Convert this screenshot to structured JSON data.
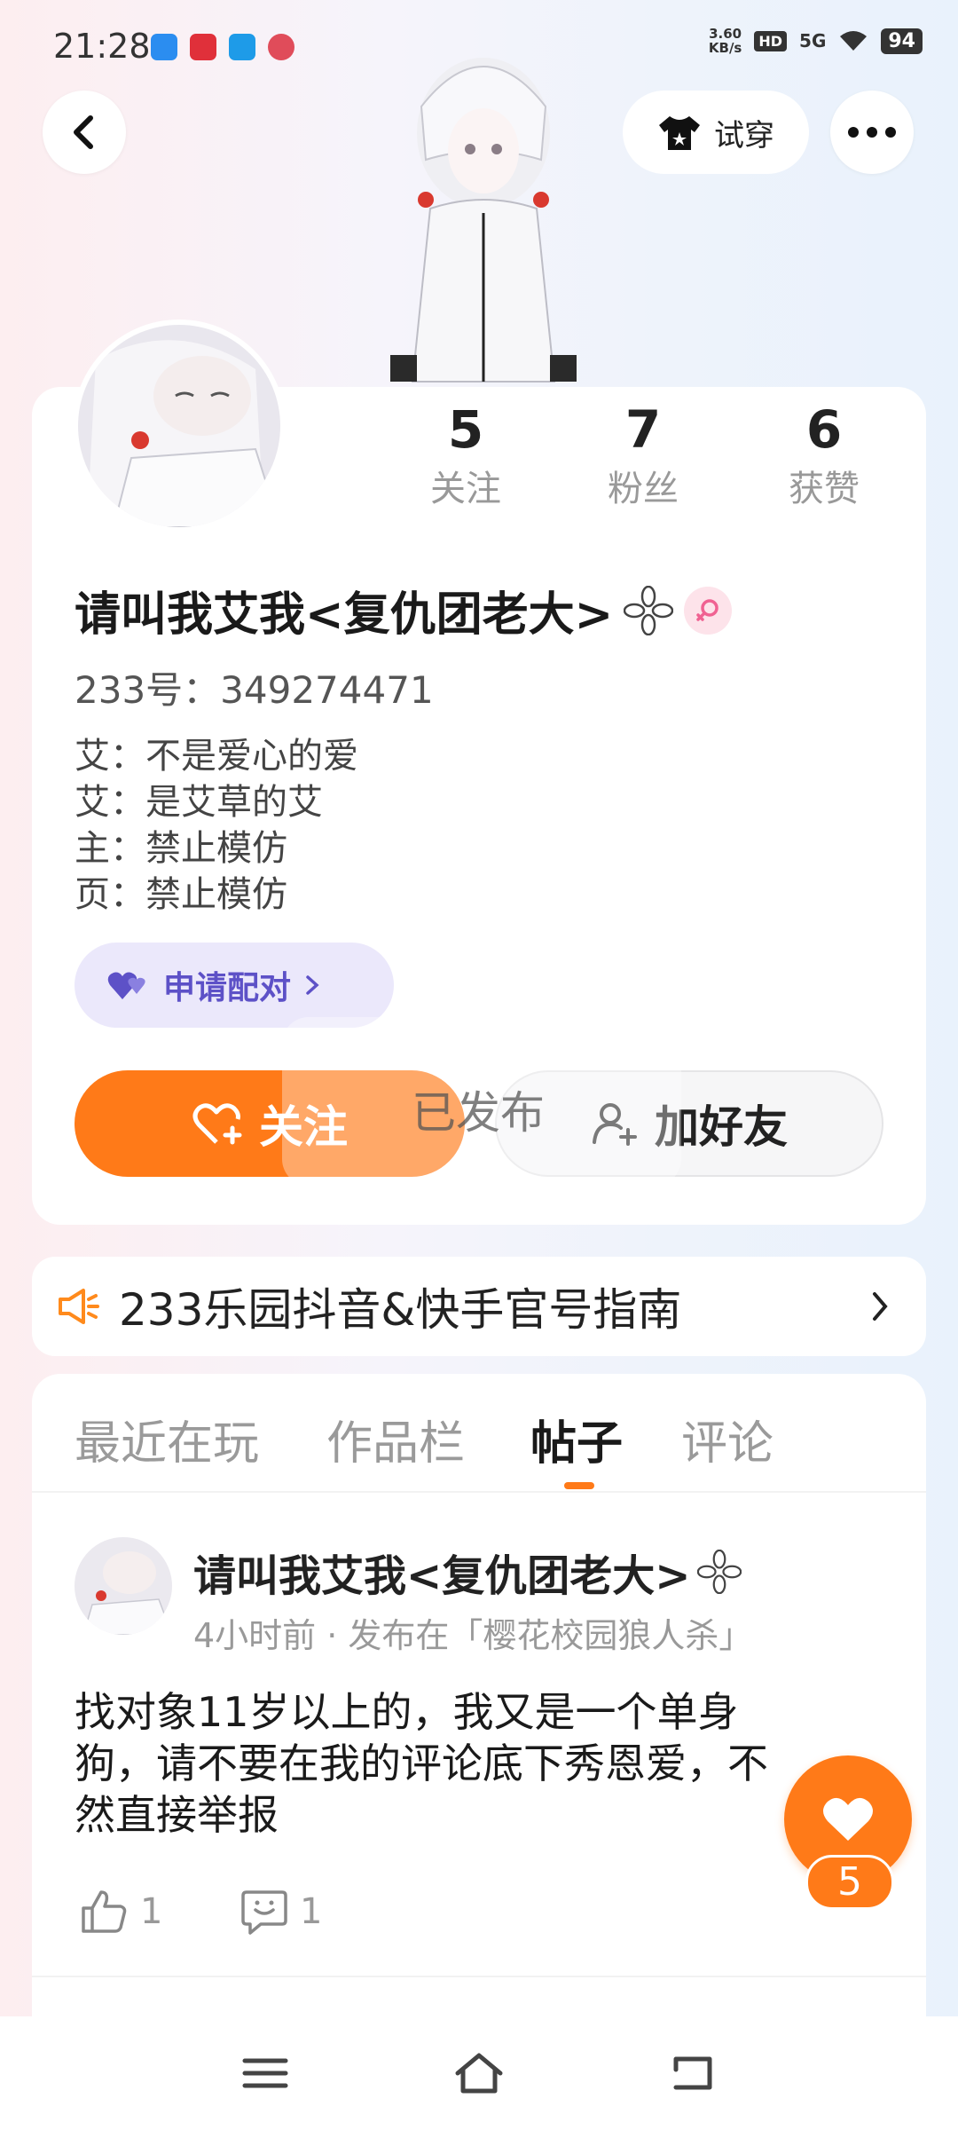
{
  "status_bar": {
    "time": "21:28",
    "net_speed_value": "3.60",
    "net_speed_unit": "KB/s",
    "hd": "HD",
    "network": "5G",
    "battery": "94"
  },
  "header": {
    "try_on_label": "试穿"
  },
  "profile": {
    "stats": [
      {
        "value": "5",
        "label": "关注"
      },
      {
        "value": "7",
        "label": "粉丝"
      },
      {
        "value": "6",
        "label": "获赞"
      }
    ],
    "username": "请叫我艾我<复仇团老大>",
    "id_line": "233号：349274471",
    "bio": [
      "艾：不是爱心的爱",
      "艾：是艾草的艾",
      "主：禁止模仿",
      "页：禁止模仿"
    ],
    "pair_label": "申请配对",
    "follow_label": "关注",
    "add_friend_label": "加好友",
    "toast": "已发布"
  },
  "notice": {
    "text": "233乐园抖音&快手官号指南"
  },
  "tabs": [
    {
      "label": "最近在玩",
      "active": false
    },
    {
      "label": "作品栏",
      "active": false
    },
    {
      "label": "帖子",
      "active": true
    },
    {
      "label": "评论",
      "active": false
    }
  ],
  "post": {
    "author": "请叫我艾我<复仇团老大>",
    "meta": "4小时前 · 发布在「樱花校园狼人杀」",
    "body_lines": [
      "找对象11岁以上的，我又是一个单身",
      "狗，请不要在我的评论底下秀恩爱，不",
      "然直接举报"
    ],
    "likes": "1",
    "comments": "1"
  },
  "float_like": {
    "count": "5"
  },
  "colors": {
    "accent": "#ff7a18",
    "pair_bg": "#ebe8fb",
    "pair_text": "#5d51c7"
  }
}
